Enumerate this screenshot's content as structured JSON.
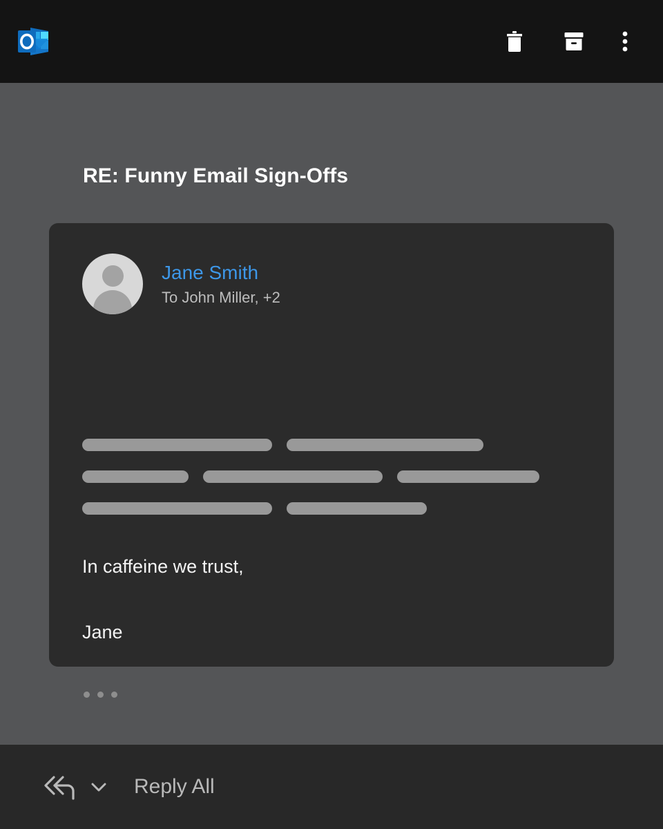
{
  "app": {
    "name": "Outlook",
    "logo_icon": "outlook-logo-icon"
  },
  "header": {
    "actions": [
      {
        "name": "delete",
        "label": "Delete",
        "icon": "trash-icon"
      },
      {
        "name": "archive",
        "label": "Archive",
        "icon": "archive-icon"
      },
      {
        "name": "more",
        "label": "More options",
        "icon": "more-vertical-icon"
      }
    ]
  },
  "message": {
    "subject": "RE: Funny Email Sign-Offs",
    "sender": "Jane Smith",
    "recipients": "To John Miller, +2",
    "avatar_icon": "person-avatar-icon",
    "body_redacted_rows": [
      [
        275,
        285
      ],
      [
        154,
        260,
        206
      ],
      [
        275,
        203
      ]
    ],
    "signoff": "In caffeine we trust,",
    "signature": "Jane",
    "show_more_icon": "ellipsis-icon"
  },
  "action_bar": {
    "reply_all_label": "Reply All",
    "reply_all_icon": "reply-all-icon",
    "dropdown_icon": "chevron-down-icon"
  },
  "colors": {
    "header_bg": "#141414",
    "pane_bg": "#545557",
    "card_bg": "#2b2b2b",
    "action_bar_bg": "#282828",
    "accent_blue": "#3d97e8",
    "placeholder_gray": "#999999",
    "brand_blue": "#0f6cbd"
  }
}
